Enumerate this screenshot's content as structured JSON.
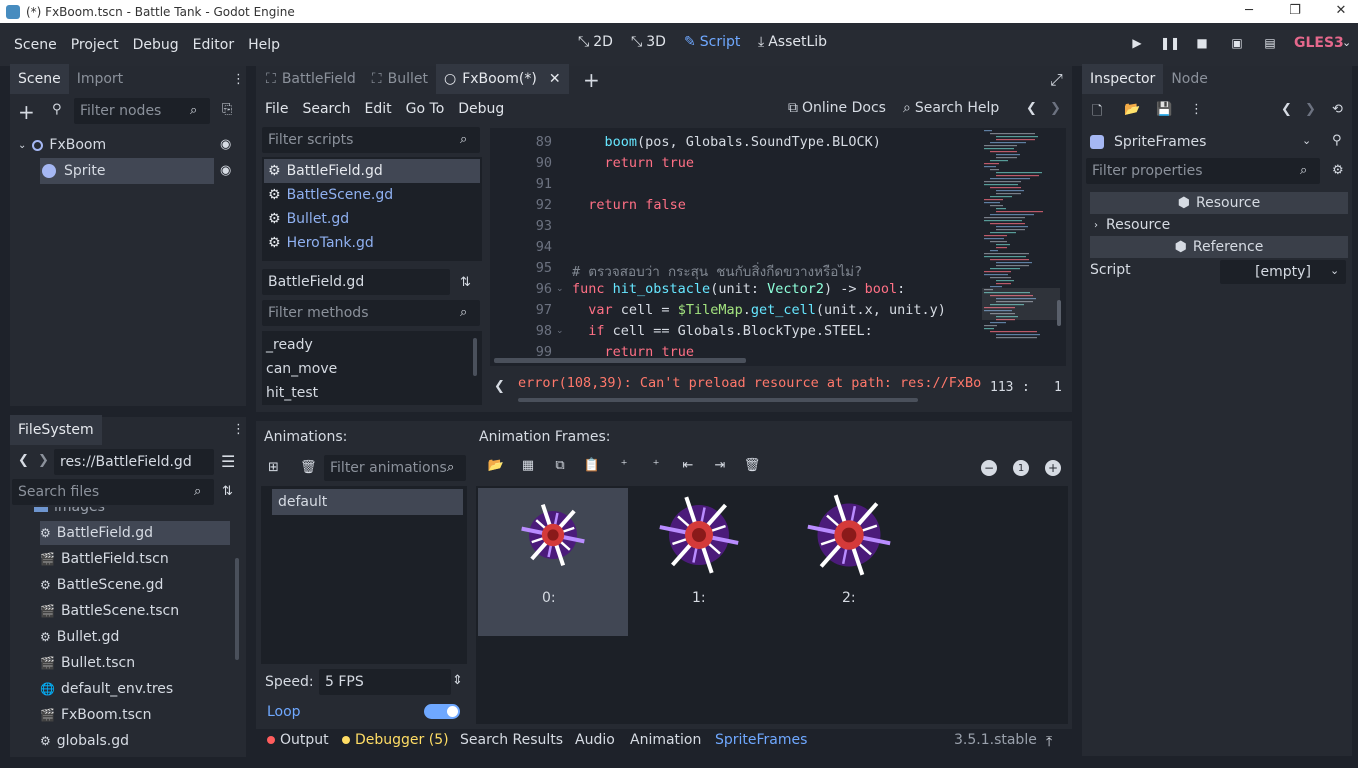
{
  "window": {
    "title": "(*) FxBoom.tscn - Battle Tank - Godot Engine",
    "minimize": "─",
    "restore": "❐",
    "close": "✕"
  },
  "menus": [
    "Scene",
    "Project",
    "Debug",
    "Editor",
    "Help"
  ],
  "workspaces": {
    "w2d": "2D",
    "w3d": "3D",
    "script": "Script",
    "assetlib": "AssetLib",
    "active": "Script"
  },
  "renderer": "GLES3",
  "scene_dock": {
    "tabs": [
      "Scene",
      "Import"
    ],
    "filter_placeholder": "Filter nodes",
    "tree": [
      {
        "label": "FxBoom",
        "icon": "node2d-icon"
      },
      {
        "label": "Sprite",
        "icon": "sprite-icon",
        "selected": true
      }
    ]
  },
  "filesystem": {
    "title": "FileSystem",
    "path": "res://BattleField.gd",
    "search_placeholder": "Search files",
    "partial_folder": "images",
    "items": [
      {
        "name": "BattleField.gd",
        "icon": "gear-icon",
        "selected": true
      },
      {
        "name": "BattleField.tscn",
        "icon": "clapper-icon"
      },
      {
        "name": "BattleScene.gd",
        "icon": "gear-icon"
      },
      {
        "name": "BattleScene.tscn",
        "icon": "clapper-icon"
      },
      {
        "name": "Bullet.gd",
        "icon": "gear-icon"
      },
      {
        "name": "Bullet.tscn",
        "icon": "clapper-icon"
      },
      {
        "name": "default_env.tres",
        "icon": "globe-icon"
      },
      {
        "name": "FxBoom.tscn",
        "icon": "clapper-icon"
      },
      {
        "name": "globals.gd",
        "icon": "gear-icon"
      }
    ]
  },
  "editor_tabs": [
    {
      "label": "BattleField",
      "active": false
    },
    {
      "label": "Bullet",
      "active": false
    },
    {
      "label": "FxBoom(*)",
      "active": true
    }
  ],
  "script_menu": [
    "File",
    "Search",
    "Edit",
    "Go To",
    "Debug"
  ],
  "script_help": {
    "online_docs": "Online Docs",
    "search_help": "Search Help"
  },
  "scripts": {
    "filter_placeholder": "Filter scripts",
    "list": [
      "BattleField.gd",
      "BattleScene.gd",
      "Bullet.gd",
      "HeroTank.gd"
    ],
    "current": "BattleField.gd",
    "methods_placeholder": "Filter methods",
    "methods": [
      "_ready",
      "can_move",
      "hit_test"
    ]
  },
  "code": {
    "line_numbers": [
      "89",
      "90",
      "91",
      "92",
      "93",
      "94",
      "95",
      "96",
      "97",
      "98",
      "99"
    ],
    "error": "error(108,39): Can't preload resource at path: res://FxBo",
    "line": "113",
    "col": "1"
  },
  "animations": {
    "title": "Animations:",
    "filter_placeholder": "Filter animations",
    "list": [
      "default"
    ],
    "speed_label": "Speed:",
    "speed_value": "5 FPS",
    "loop_label": "Loop",
    "loop": true
  },
  "frames": {
    "title": "Animation Frames:",
    "labels": [
      "0:",
      "1:",
      "2:"
    ]
  },
  "bottom_panel": {
    "tabs": [
      "Output",
      "Debugger (5)",
      "Search Results",
      "Audio",
      "Animation",
      "SpriteFrames"
    ],
    "version": "3.5.1.stable"
  },
  "inspector": {
    "tabs": [
      "Inspector",
      "Node"
    ],
    "resource_type": "SpriteFrames",
    "filter_placeholder": "Filter properties",
    "section_resource": "Resource",
    "sub_resource": "Resource",
    "section_reference": "Reference",
    "script_label": "Script",
    "script_value": "[empty]"
  },
  "colors": {
    "accent": "#6fa8ff",
    "error": "#ff786b",
    "bg": "#1e222a",
    "panel": "#262a32"
  }
}
